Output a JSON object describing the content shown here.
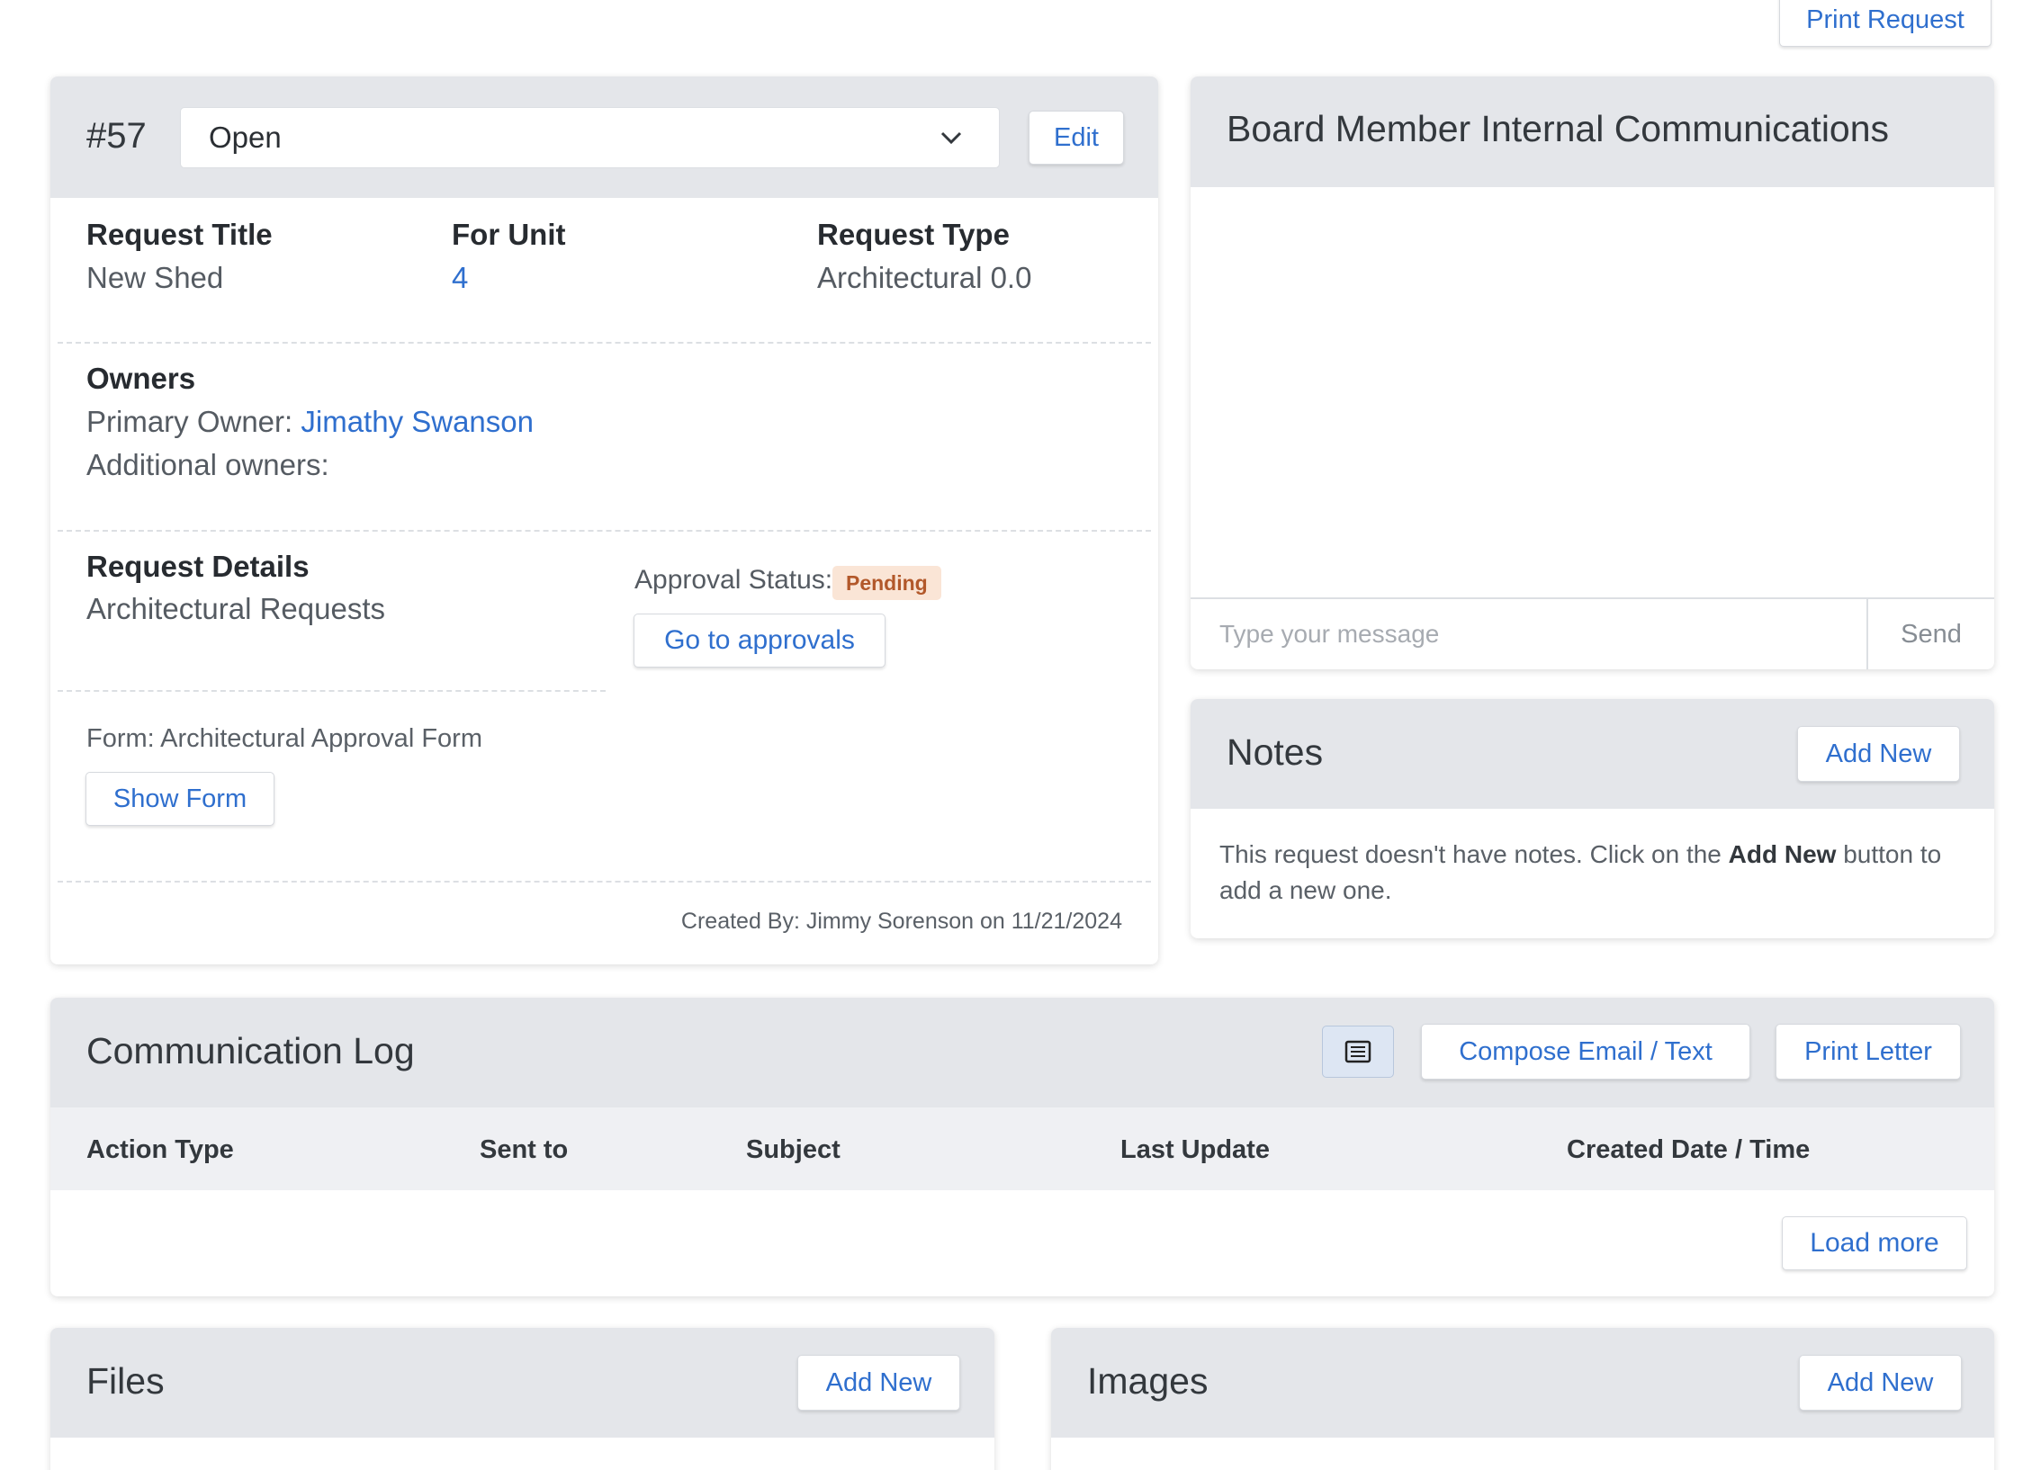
{
  "top": {
    "print_request": "Print Request"
  },
  "request": {
    "number": "#57",
    "status_value": "Open",
    "edit_label": "Edit",
    "title_label": "Request Title",
    "title_value": "New Shed",
    "unit_label": "For Unit",
    "unit_value": "4",
    "type_label": "Request Type",
    "type_value": "Architectural 0.0",
    "owners_label": "Owners",
    "primary_owner_label": "Primary Owner:",
    "primary_owner_name": "Jimathy Swanson",
    "additional_owners_label": "Additional owners:",
    "details_label": "Request Details",
    "details_value": "Architectural Requests",
    "approval_status_label": "Approval Status:",
    "approval_status_badge": "Pending",
    "go_to_approvals": "Go to approvals",
    "form_label": "Form: Architectural Approval Form",
    "show_form": "Show Form",
    "created_by": "Created By: Jimmy Sorenson on 11/21/2024"
  },
  "board": {
    "title": "Board Member Internal Communications",
    "message_placeholder": "Type your message",
    "send_label": "Send"
  },
  "notes": {
    "title": "Notes",
    "add_new": "Add New",
    "empty_prefix": "This request doesn't have notes. Click on the ",
    "empty_bold": "Add New",
    "empty_suffix": " button to add a new one."
  },
  "comm_log": {
    "title": "Communication Log",
    "compose": "Compose Email / Text",
    "print_letter": "Print Letter",
    "columns": [
      "Action Type",
      "Sent to",
      "Subject",
      "Last Update",
      "Created Date / Time"
    ],
    "load_more": "Load more"
  },
  "files": {
    "title": "Files",
    "add_new": "Add New"
  },
  "images": {
    "title": "Images",
    "add_new": "Add New"
  },
  "colors": {
    "accent": "#2f6fce",
    "header_bg": "#e4e6ea",
    "badge_bg": "#fae5d6",
    "badge_text": "#b2582a"
  },
  "icons": {
    "status_dropdown": "chevron-down-icon",
    "view_toggle": "list-view-icon"
  }
}
